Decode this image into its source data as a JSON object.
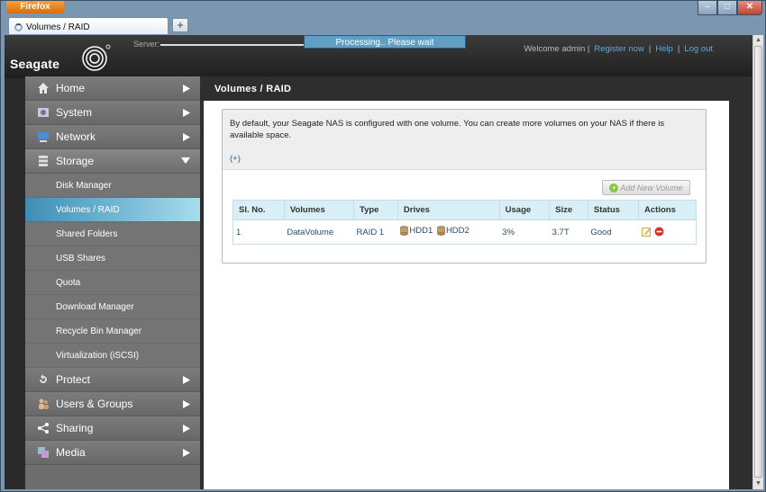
{
  "browser": {
    "app_button": "Firefox",
    "tab_title": "Volumes / RAID",
    "new_tab": "+",
    "window_min": "–",
    "window_max": "□",
    "window_close": "✕"
  },
  "header": {
    "logo_text": "Seagate",
    "server_label": "Server:",
    "processing": "Processing.. Please wait",
    "welcome": "Welcome admin |",
    "register": "Register now",
    "sep1": "|",
    "help": "Help",
    "sep2": "|",
    "logout": "Log out"
  },
  "sidebar": {
    "items": [
      {
        "label": "Home",
        "icon": "home-icon"
      },
      {
        "label": "System",
        "icon": "system-icon"
      },
      {
        "label": "Network",
        "icon": "network-icon"
      },
      {
        "label": "Storage",
        "icon": "storage-icon",
        "expanded": true
      },
      {
        "label": "Protect",
        "icon": "protect-icon"
      },
      {
        "label": "Users & Groups",
        "icon": "users-icon"
      },
      {
        "label": "Sharing",
        "icon": "sharing-icon"
      },
      {
        "label": "Media",
        "icon": "media-icon"
      }
    ],
    "storage_sub": [
      {
        "label": "Disk Manager"
      },
      {
        "label": "Volumes / RAID",
        "active": true
      },
      {
        "label": "Shared Folders"
      },
      {
        "label": "USB Shares"
      },
      {
        "label": "Quota"
      },
      {
        "label": "Download Manager"
      },
      {
        "label": "Recycle Bin Manager"
      },
      {
        "label": "Virtualization (iSCSI)"
      }
    ]
  },
  "main": {
    "title": "Volumes / RAID",
    "info": "By default, your Seagate NAS is configured with one volume. You can create more volumes on your NAS if there is available space.",
    "add_link": "(+)",
    "add_button": "Add New Volume",
    "table": {
      "headers": [
        "Sl. No.",
        "Volumes",
        "Type",
        "Drives",
        "Usage",
        "Size",
        "Status",
        "Actions"
      ],
      "rows": [
        {
          "no": "1",
          "volume": "DataVolume",
          "type": "RAID 1",
          "drives": [
            "HDD1",
            "HDD2"
          ],
          "usage": "3%",
          "size": "3.7T",
          "status": "Good"
        }
      ]
    }
  },
  "colors": {
    "accent": "#5f9fc6",
    "active_nav": "#3d8eb4",
    "link": "#1a5fa0"
  }
}
